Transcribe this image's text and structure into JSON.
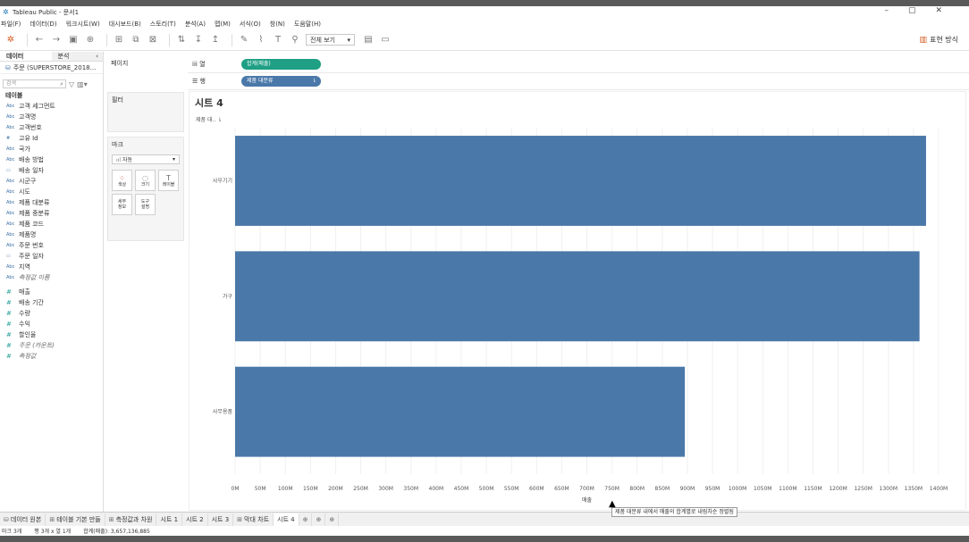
{
  "app": {
    "title": "Tableau Public - 문서1",
    "window_controls": [
      "–",
      "▢",
      "✕"
    ]
  },
  "menu": [
    "파일(F)",
    "데이터(D)",
    "워크시트(W)",
    "대시보드(B)",
    "스토리(T)",
    "분석(A)",
    "맵(M)",
    "서식(O)",
    "창(N)",
    "도움말(H)"
  ],
  "toolbar": {
    "view_mode": "전체 보기",
    "show_me": "표현 방식"
  },
  "left_panel": {
    "tab_data": "데이터",
    "tab_analysis": "분석",
    "collapse": "‹",
    "datasource": "주문 (SUPERSTORE_2018...",
    "search_placeholder": "검색",
    "section_tables": "테이블",
    "dimensions": [
      {
        "type": "Abc",
        "name": "고객 세그먼트"
      },
      {
        "type": "Abc",
        "name": "고객명"
      },
      {
        "type": "Abc",
        "name": "고객번호"
      },
      {
        "type": "#",
        "name": "고유 Id"
      },
      {
        "type": "Abc",
        "name": "국가"
      },
      {
        "type": "Abc",
        "name": "배송 방법"
      },
      {
        "type": "▭",
        "name": "배송 일자"
      },
      {
        "type": "Abc",
        "name": "시군구"
      },
      {
        "type": "Abc",
        "name": "시도"
      },
      {
        "type": "Abc",
        "name": "제품 대분류"
      },
      {
        "type": "Abc",
        "name": "제품 중분류"
      },
      {
        "type": "Abc",
        "name": "제품 코드"
      },
      {
        "type": "Abc",
        "name": "제품명"
      },
      {
        "type": "Abc",
        "name": "주문 번호"
      },
      {
        "type": "▭",
        "name": "주문 일자"
      },
      {
        "type": "Abc",
        "name": "지역"
      },
      {
        "type": "Abc",
        "name": "측정값 이름"
      }
    ],
    "measures": [
      {
        "type": "#",
        "name": "매출"
      },
      {
        "type": "#",
        "name": "배송 기간"
      },
      {
        "type": "#",
        "name": "수량"
      },
      {
        "type": "#",
        "name": "수익"
      },
      {
        "type": "#",
        "name": "할인율"
      },
      {
        "type": "#",
        "name": "주문 (카운트)"
      },
      {
        "type": "#",
        "name": "측정값"
      }
    ]
  },
  "cards": {
    "pages": "페이지",
    "filters": "필터",
    "marks": "마크",
    "marks_type": "자동",
    "mark_buttons": [
      {
        "icon": "⁘",
        "label": "색상"
      },
      {
        "icon": "◌",
        "label": "크기"
      },
      {
        "icon": "T",
        "label": "레이블"
      },
      {
        "icon": "",
        "label": "세부\n정보"
      },
      {
        "icon": "",
        "label": "도구\n설명"
      }
    ]
  },
  "shelves": {
    "columns_label": "열",
    "columns_pill": "합계(매출)",
    "rows_label": "행",
    "rows_pill": "제품 대분류"
  },
  "sheet": {
    "title": "시트 4",
    "row_header": "제품 대.."
  },
  "chart_data": {
    "type": "bar",
    "orientation": "horizontal",
    "categories": [
      "사무기기",
      "가구",
      "사무용품"
    ],
    "values": [
      1375,
      1362,
      895
    ],
    "unit": "M",
    "xlabel": "매출",
    "x_ticks": [
      "0M",
      "50M",
      "100M",
      "150M",
      "200M",
      "250M",
      "300M",
      "350M",
      "400M",
      "450M",
      "500M",
      "550M",
      "600M",
      "650M",
      "700M",
      "750M",
      "800M",
      "850M",
      "900M",
      "950M",
      "1000M",
      "1050M",
      "1100M",
      "1150M",
      "1200M",
      "1250M",
      "1300M",
      "1350M",
      "1400M"
    ],
    "xlim": [
      0,
      1400
    ],
    "bar_color": "#4a78a9",
    "grid": true
  },
  "tooltip": "제품 대분류 내에서 매출의 합계별로 내림차순 정렬됨",
  "sheet_tabs": [
    {
      "icon": "⛁",
      "label": "데이터 원본",
      "active": false
    },
    {
      "icon": "⊞",
      "label": "테이블 기본 만들",
      "active": false
    },
    {
      "icon": "⊞",
      "label": "측정값과 차원",
      "active": false
    },
    {
      "icon": "",
      "label": "시트 1",
      "active": false
    },
    {
      "icon": "",
      "label": "시트 2",
      "active": false
    },
    {
      "icon": "",
      "label": "시트 3",
      "active": false
    },
    {
      "icon": "⊞",
      "label": "막대 차트",
      "active": false
    },
    {
      "icon": "",
      "label": "시트 4",
      "active": true
    }
  ],
  "status": {
    "marks": "마크 3개",
    "rows_cols": "행 3개 x 열 1개",
    "sum": "합계(매출): 3,657,136,885"
  }
}
